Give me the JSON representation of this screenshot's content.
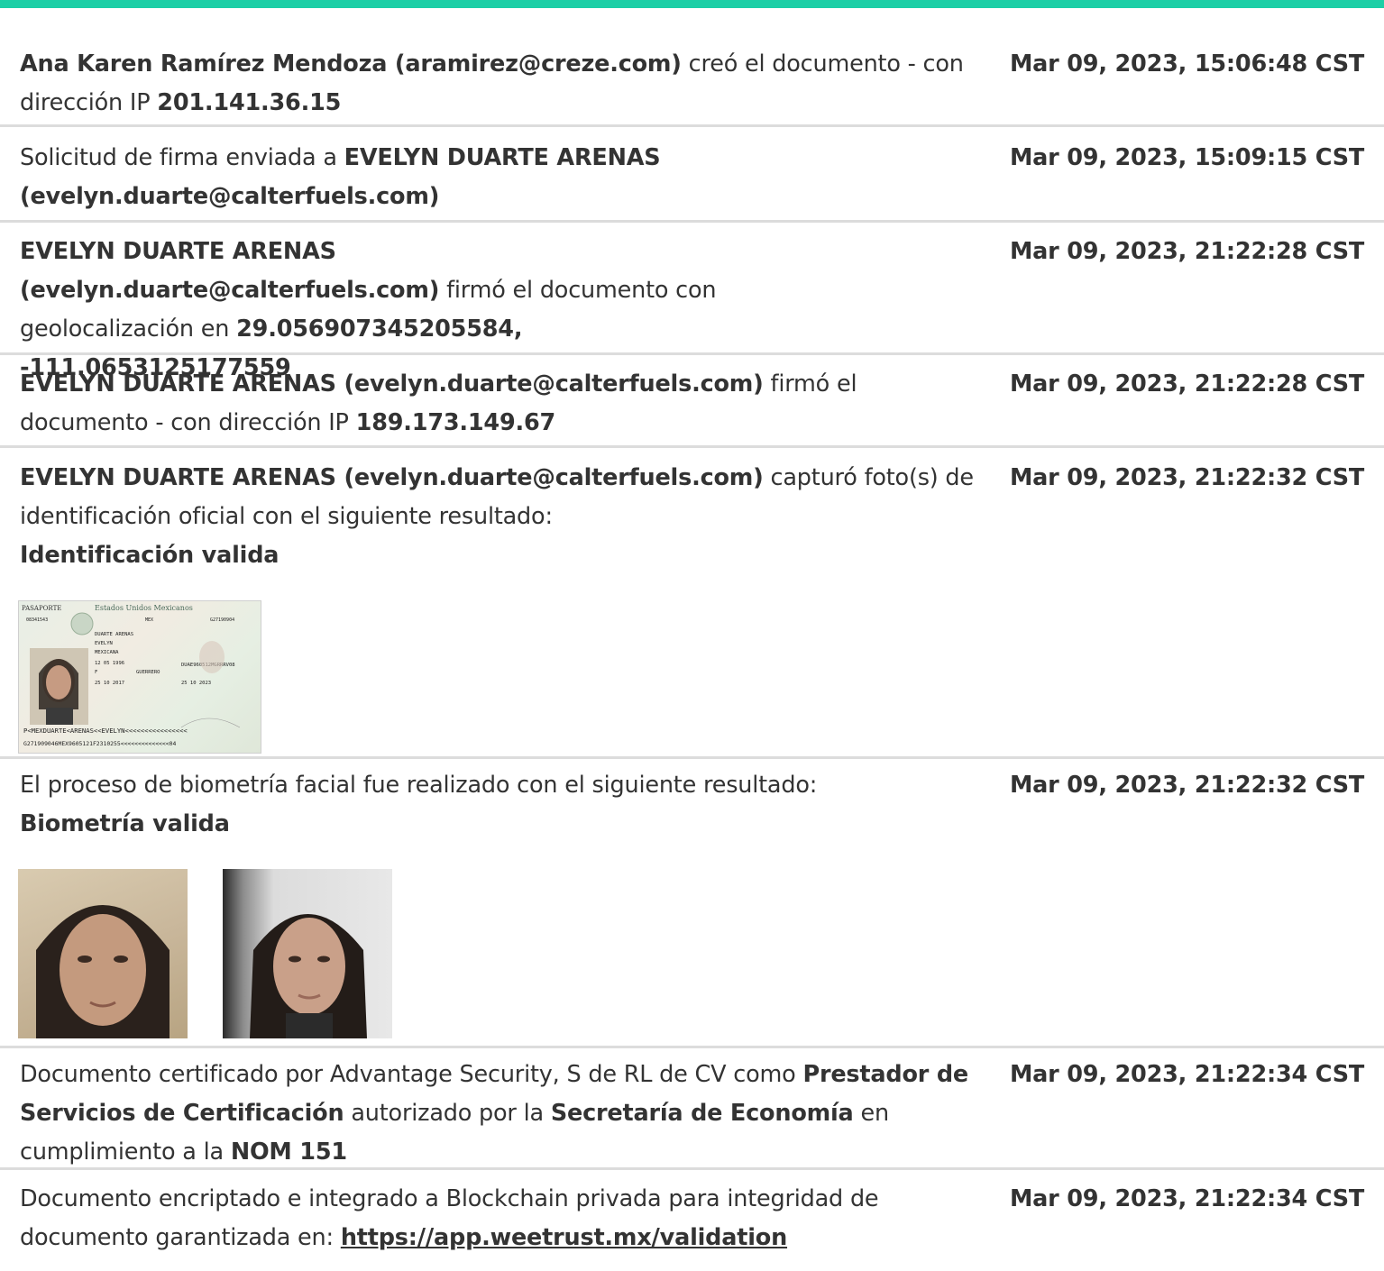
{
  "entries": [
    {
      "parts": [
        {
          "t": "Ana Karen Ramírez Mendoza (aramirez@creze.com)",
          "b": true
        },
        {
          "t": " creó el documento - con dirección IP ",
          "b": false
        },
        {
          "t": "201.141.36.15",
          "b": true
        }
      ],
      "timestamp": "Mar 09, 2023, 15:06:48 CST"
    },
    {
      "parts": [
        {
          "t": "Solicitud de firma enviada a ",
          "b": false
        },
        {
          "t": "EVELYN DUARTE ARENAS (evelyn.duarte@calterfuels.com)",
          "b": true
        }
      ],
      "timestamp": "Mar 09, 2023, 15:09:15 CST"
    },
    {
      "parts": [
        {
          "t": "EVELYN DUARTE ARENAS (evelyn.duarte@calterfuels.com)",
          "b": true
        },
        {
          "t": " firmó el documento con geolocalización en ",
          "b": false
        },
        {
          "t": "29.056907345205584, -111.0653125177559",
          "b": true
        }
      ],
      "timestamp": "Mar 09, 2023, 21:22:28 CST"
    },
    {
      "parts": [
        {
          "t": "EVELYN DUARTE ARENAS (evelyn.duarte@calterfuels.com)",
          "b": true
        },
        {
          "t": " firmó el documento - con dirección IP ",
          "b": false
        },
        {
          "t": "189.173.149.67",
          "b": true
        }
      ],
      "timestamp": "Mar 09, 2023, 21:22:28 CST"
    },
    {
      "parts": [
        {
          "t": "EVELYN DUARTE ARENAS (evelyn.duarte@calterfuels.com)",
          "b": true
        },
        {
          "t": " capturó foto(s) de identificación oficial con el siguiente resultado:",
          "b": false
        }
      ],
      "result": "Identificación valida",
      "timestamp": "Mar 09, 2023, 21:22:32 CST"
    },
    {
      "parts": [
        {
          "t": "El proceso de biometría facial fue realizado con el siguiente resultado:",
          "b": false
        }
      ],
      "result": "Biometría valida",
      "timestamp": "Mar 09, 2023, 21:22:32 CST"
    },
    {
      "parts": [
        {
          "t": "Documento certificado por Advantage Security, S de RL de CV como ",
          "b": false
        },
        {
          "t": "Prestador de Servicios de Certificación",
          "b": true
        },
        {
          "t": " autorizado por la ",
          "b": false
        },
        {
          "t": "Secretaría de Economía",
          "b": true
        },
        {
          "t": " en cumplimiento a la ",
          "b": false
        },
        {
          "t": "NOM 151",
          "b": true
        }
      ],
      "timestamp": "Mar 09, 2023, 21:22:34 CST"
    },
    {
      "parts": [
        {
          "t": "Documento encriptado e integrado a Blockchain privada para integridad de documento garantizada en: ",
          "b": false
        }
      ],
      "link": "https://app.weetrust.mx/validation",
      "timestamp": "Mar 09, 2023, 21:22:34 CST"
    }
  ],
  "passport": {
    "type": "PASAPORTE",
    "country": "Estados Unidos Mexicanos",
    "number": "G27190904",
    "doc_code": "MEX",
    "surname": "DUARTE ARENAS",
    "given": "EVELYN",
    "nationality": "MEXICANA",
    "birth_date": "12 05 1996",
    "sex": "F",
    "birth_place": "GUERRERO",
    "issue_date": "25 10 2017",
    "expiry_date": "25 10 2023",
    "curp": "DUAE960512MGRRRV08",
    "serial": "08341543",
    "mrz1": "P<MEXDUARTE<ARENAS<<EVELYN<<<<<<<<<<<<<<<<",
    "mrz2": "G271909046MEX9605121F2310255<<<<<<<<<<<<<<04"
  }
}
